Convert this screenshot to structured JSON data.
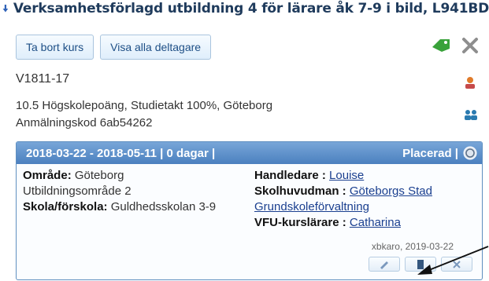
{
  "header": {
    "title": "Verksamhetsförlagd utbildning 4 för lärare åk 7-9 i bild, L941BD"
  },
  "toolbar": {
    "remove_course": "Ta bort kurs",
    "show_participants": "Visa alla deltagare"
  },
  "course": {
    "code": "V1811-17",
    "details": "10.5 Högskolepoäng, Studietakt 100%, Göteborg",
    "application_code": "Anmälningskod 6ab54262"
  },
  "placement": {
    "header_dates": "2018-03-22 - 2018-05-11 | 0 dagar |",
    "status": "Placerad |",
    "area_label": "Område",
    "area_value": "Göteborg",
    "education_area": "Utbildningsområde 2",
    "school_label": "Skola/förskola",
    "school_value": "Guldhedsskolan 3-9",
    "supervisor_label": "Handledare",
    "supervisor_value": "Louise",
    "principal_label": "Skolhuvudman",
    "principal_value": "Göteborgs Stad",
    "principal_sub": "Grundskoleförvaltning",
    "teacher_label": "VFU-kurslärare",
    "teacher_value": "Catharina",
    "edited_meta": "xbkaro, 2019-03-22"
  },
  "icons": {
    "tag": "tag-icon",
    "close": "close-icon",
    "user": "user-icon",
    "group": "group-icon",
    "edit": "edit-icon",
    "document": "document-icon",
    "delete": "delete-icon",
    "info": "info-icon"
  },
  "colors": {
    "accent": "#4b80bf",
    "title": "#1f3b5c",
    "link": "#1a3f8f"
  }
}
